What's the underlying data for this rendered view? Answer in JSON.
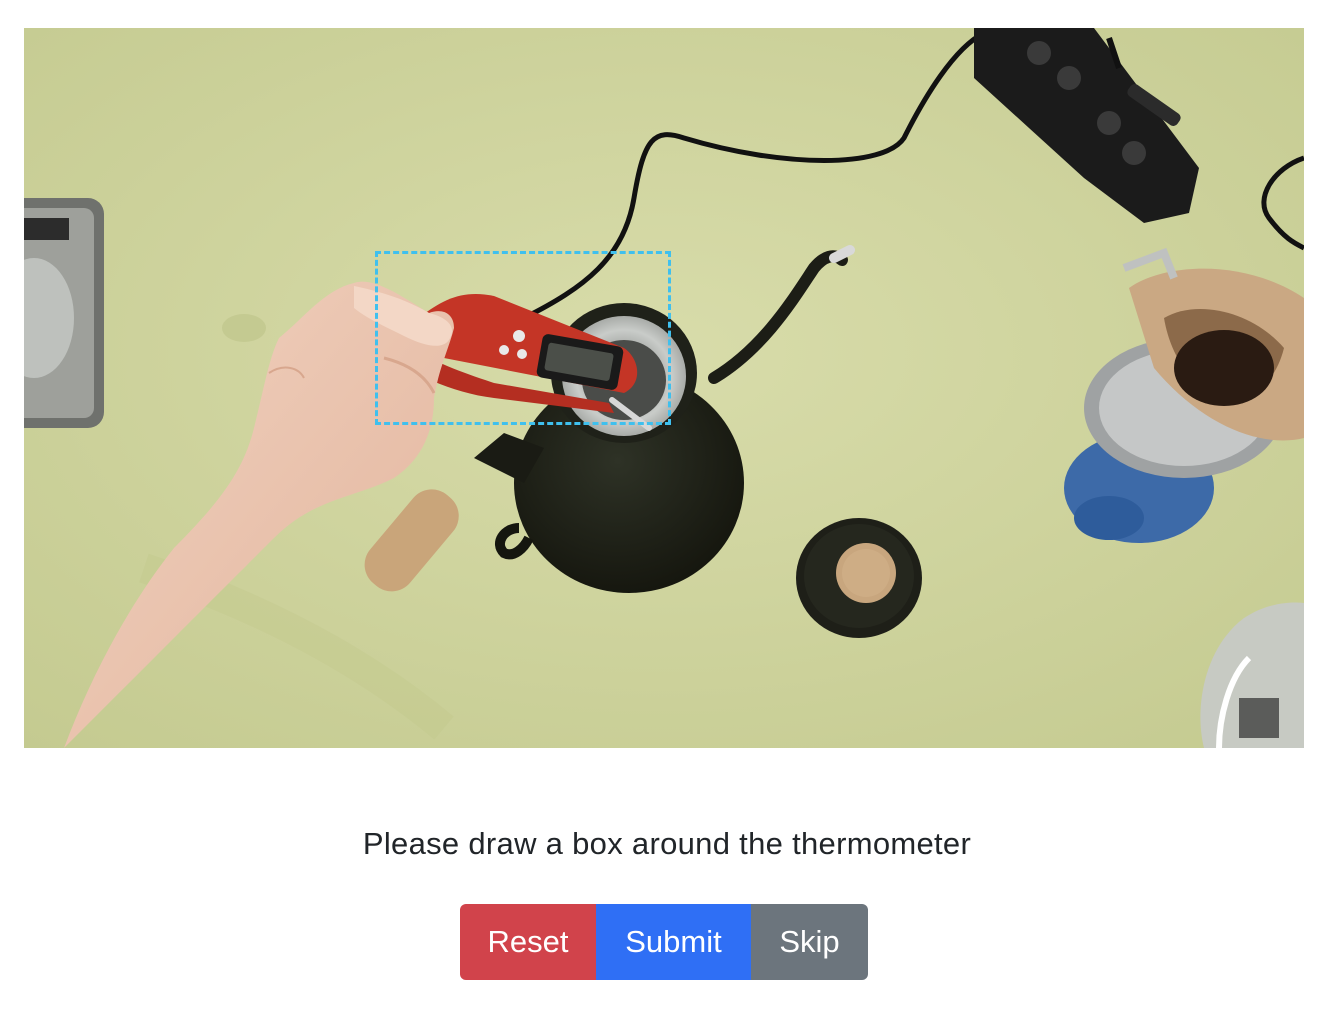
{
  "task": {
    "prompt": "Please draw a box around the thermometer"
  },
  "buttons": {
    "reset_label": "Reset",
    "submit_label": "Submit",
    "skip_label": "Skip"
  },
  "colors": {
    "reset": "#d1434b",
    "submit": "#2f6ff5",
    "skip": "#6c757d",
    "selection": "#3fc0ee",
    "tablecloth": "#d3d8a4"
  }
}
